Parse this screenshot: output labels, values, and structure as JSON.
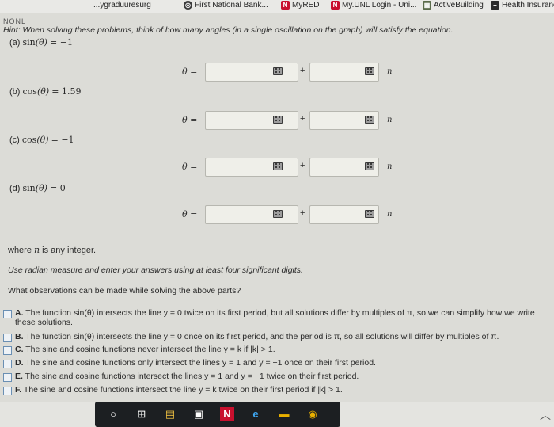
{
  "bookmarks": [
    {
      "label": "...ygraduuresurg",
      "icon": "bookmark-icon"
    },
    {
      "label": "First National Bank...",
      "icon": "bank-icon"
    },
    {
      "label": "MyRED",
      "icon": "n-logo-icon"
    },
    {
      "label": "My.UNL Login - Uni...",
      "icon": "n-logo-icon"
    },
    {
      "label": "ActiveBuilding",
      "icon": "building-icon"
    },
    {
      "label": "Health Insurance",
      "icon": "health-icon"
    }
  ],
  "header_clip": "NONL",
  "hint": "Hint: When solving these problems, think of how many angles (in a single oscillation on the graph) will satisfy the equation.",
  "problems": [
    {
      "label": "(a)",
      "func": "sin",
      "arg": "(θ)",
      "rhs": "= −1",
      "theta": "θ =",
      "plus": "+",
      "n": "n",
      "value1": "",
      "value2": ""
    },
    {
      "label": "(b)",
      "func": "cos",
      "arg": "(θ)",
      "rhs": "= 1.59",
      "theta": "θ =",
      "plus": "+",
      "n": "n",
      "value1": "",
      "value2": ""
    },
    {
      "label": "(c)",
      "func": "cos",
      "arg": "(θ)",
      "rhs": "= −1",
      "theta": "θ =",
      "plus": "+",
      "n": "n",
      "value1": "",
      "value2": ""
    },
    {
      "label": "(d)",
      "func": "sin",
      "arg": "(θ)",
      "rhs": "= 0",
      "theta": "θ =",
      "plus": "+",
      "n": "n",
      "value1": "",
      "value2": ""
    }
  ],
  "where_pre": "where ",
  "where_n": "n",
  "where_post": " is any integer.",
  "radian_note": "Use radian measure and enter your answers using at least four significant digits.",
  "question": "What observations can be made while solving the above parts?",
  "options": [
    {
      "letter": "A.",
      "text": "The function sin(θ) intersects the line y = 0 twice on its first period, but all solutions differ by multiples of π, so we can simplify how we write these solutions.",
      "checked": false
    },
    {
      "letter": "B.",
      "text": "The function sin(θ) intersects the line y = 0 once on its first period, and the period is π, so all solutions will differ by multiples of π.",
      "checked": false
    },
    {
      "letter": "C.",
      "text": "The sine and cosine functions never intersect the line y = k if |k| > 1.",
      "checked": false
    },
    {
      "letter": "D.",
      "text": "The sine and cosine functions only intersect the lines y = 1 and y = −1 once on their first period.",
      "checked": false
    },
    {
      "letter": "E.",
      "text": "The sine and cosine functions intersect the lines y = 1 and y = −1 twice on their first period.",
      "checked": false
    },
    {
      "letter": "F.",
      "text": "The sine and cosine functions intersect the line y = k twice on their first period if |k| > 1.",
      "checked": false
    }
  ],
  "taskbar": [
    {
      "name": "search-circle-icon",
      "glyph": "○"
    },
    {
      "name": "task-view-icon",
      "glyph": "⊞"
    },
    {
      "name": "file-explorer-icon",
      "glyph": "▤"
    },
    {
      "name": "store-icon",
      "glyph": "▣"
    },
    {
      "name": "n-app-icon",
      "glyph": "N"
    },
    {
      "name": "edge-icon",
      "glyph": "e"
    },
    {
      "name": "files-icon",
      "glyph": "▬"
    },
    {
      "name": "chrome-icon",
      "glyph": "◉"
    }
  ],
  "colors": {
    "page_bg": "#dcdcd7",
    "input_bg": "#efefe9",
    "checkbox_border": "#6a8fb3",
    "n_logo": "#c8102e",
    "chrome": "#e8b000"
  }
}
